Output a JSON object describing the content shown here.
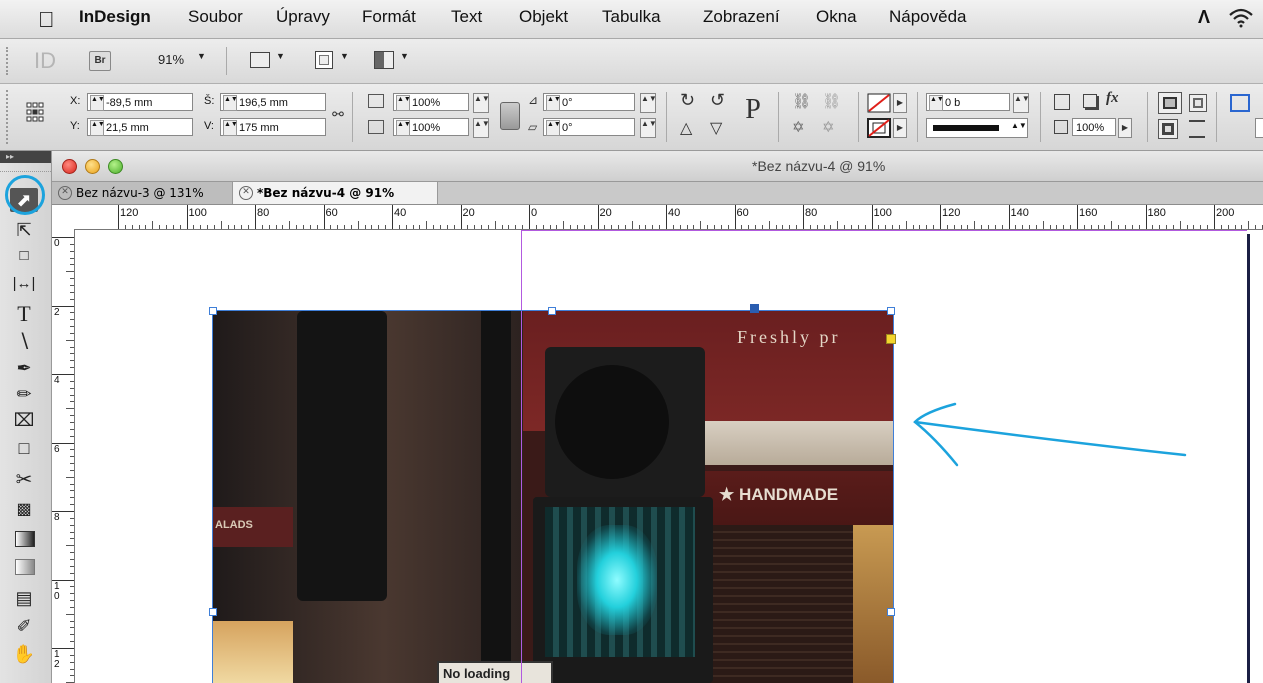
{
  "menubar": {
    "app_name": "InDesign",
    "items": [
      "Soubor",
      "Úpravy",
      "Formát",
      "Text",
      "Objekt",
      "Tabulka",
      "Zobrazení",
      "Okna",
      "Nápověda"
    ]
  },
  "appbar": {
    "app_icon": "ID",
    "bridge": "Br",
    "zoom": "91%"
  },
  "control": {
    "x_label": "X:",
    "x_value": "-89,5 mm",
    "y_label": "Y:",
    "y_value": "21,5 mm",
    "w_label": "Š:",
    "w_value": "196,5 mm",
    "h_label": "V:",
    "h_value": "175 mm",
    "scale_x": "100%",
    "scale_y": "100%",
    "rotate": "0°",
    "shear": "0°",
    "p_glyph": "P",
    "fx_glyph": "fx",
    "stroke_weight": "0 b",
    "opacity": "100%"
  },
  "document": {
    "window_title": "*Bez názvu-4 @ 91%",
    "tabs": [
      "Bez názvu-3 @ 131%",
      "*Bez názvu-4 @ 91%"
    ]
  },
  "rulers": {
    "horizontal": [
      "120",
      "100",
      "80",
      "60",
      "40",
      "20",
      "0",
      "20",
      "40",
      "60",
      "80",
      "100",
      "120",
      "140",
      "160",
      "180",
      "200"
    ],
    "vertical": [
      "0",
      "2",
      "4",
      "6",
      "8",
      "10",
      "12"
    ]
  },
  "photo": {
    "sign_text": "Freshly pr",
    "handmade_text": "HANDMADE",
    "salads_text": "ALADS",
    "loading_text": "No loading"
  },
  "colors": {
    "highlight_blue": "#1ca3dd",
    "margin_guide": "#b25adf",
    "frame_selection": "#3f7fd8"
  }
}
